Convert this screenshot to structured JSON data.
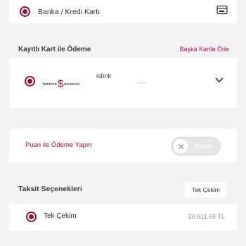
{
  "payment_method": {
    "label": "Banka / Kredi Kartı",
    "icon": "card-icon"
  },
  "saved_cards": {
    "title": "Kayıtlı Kart ile Ödeme",
    "other_card_link": "Başka Kartla Öde",
    "selected_card": {
      "bank_name_left": "TÜRKİYE",
      "bank_name_right": "BANKASI",
      "card_name": "isbnk",
      "masked_number": "****",
      "icon": "chevron-down-icon"
    }
  },
  "points": {
    "label": "Puan ile Ödeme Yapın",
    "toggle_state": "Kapalı",
    "enabled": false
  },
  "installments": {
    "title": "Taksit Seçenekleri",
    "badge": "Tek Çekim",
    "options": [
      {
        "label": "Tek Çekim",
        "amount": "20.611,65 TL",
        "selected": true
      }
    ]
  },
  "colors": {
    "accent": "#8a1538",
    "link": "#b0124c",
    "background": "#f3f3f5"
  }
}
